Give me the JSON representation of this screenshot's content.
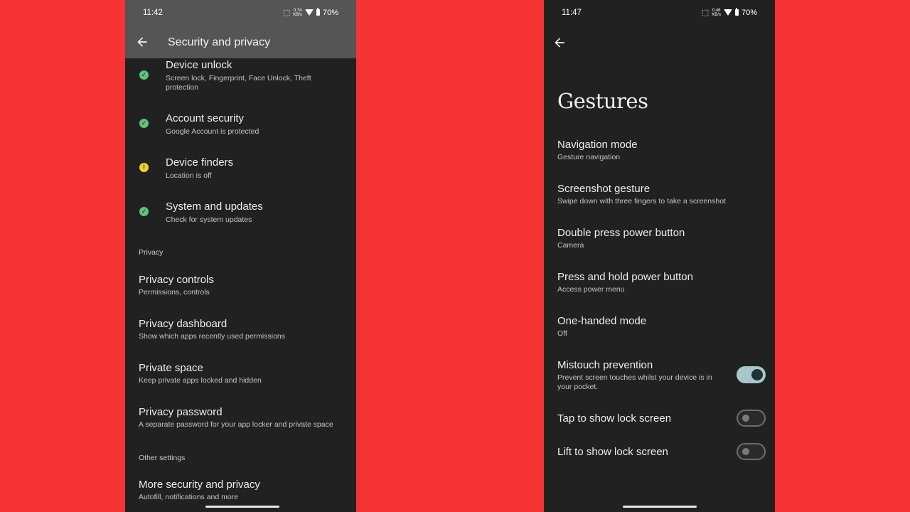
{
  "left": {
    "status": {
      "time": "11:42",
      "net_speed": "0.74",
      "net_unit": "KB/s",
      "battery": "70%"
    },
    "app_title": "Security and privacy",
    "security_items": [
      {
        "title": "Device unlock",
        "sub": "Screen lock, Fingerprint, Face Unlock, Theft protection",
        "status": "ok"
      },
      {
        "title": "Account security",
        "sub": "Google Account is protected",
        "status": "ok"
      },
      {
        "title": "Device finders",
        "sub": "Location is off",
        "status": "warning"
      },
      {
        "title": "System and updates",
        "sub": "Check for system updates",
        "status": "ok"
      }
    ],
    "privacy_header": "Privacy",
    "privacy_items": [
      {
        "title": "Privacy controls",
        "sub": "Permissions, controls"
      },
      {
        "title": "Privacy dashboard",
        "sub": "Show which apps recently used permissions"
      },
      {
        "title": "Private space",
        "sub": "Keep private apps locked and hidden"
      },
      {
        "title": "Privacy password",
        "sub": "A separate password for your app locker and private space"
      }
    ],
    "other_header": "Other settings",
    "other_items": [
      {
        "title": "More security and privacy",
        "sub": "Autofill, notifications and more"
      }
    ]
  },
  "right": {
    "status": {
      "time": "11:47",
      "net_speed": "0.46",
      "net_unit": "KB/s",
      "battery": "70%"
    },
    "page_title": "Gestures",
    "items": [
      {
        "title": "Navigation mode",
        "sub": "Gesture navigation"
      },
      {
        "title": "Screenshot gesture",
        "sub": "Swipe down with three fingers to take a screenshot"
      },
      {
        "title": "Double press power button",
        "sub": "Camera"
      },
      {
        "title": "Press and hold power button",
        "sub": "Access power menu"
      },
      {
        "title": "One-handed mode",
        "sub": "Off"
      },
      {
        "title": "Mistouch prevention",
        "sub": "Prevent screen touches whilst your device is in your pocket.",
        "toggle": true
      },
      {
        "title": "Tap to show lock screen",
        "toggle": false
      },
      {
        "title": "Lift to show lock screen",
        "toggle": false
      }
    ]
  },
  "colors": {
    "background": "#f63335",
    "screen": "#212121",
    "ok": "#5fc27e",
    "warning": "#f2cf3a",
    "toggle_on": "#a8c7c9"
  }
}
